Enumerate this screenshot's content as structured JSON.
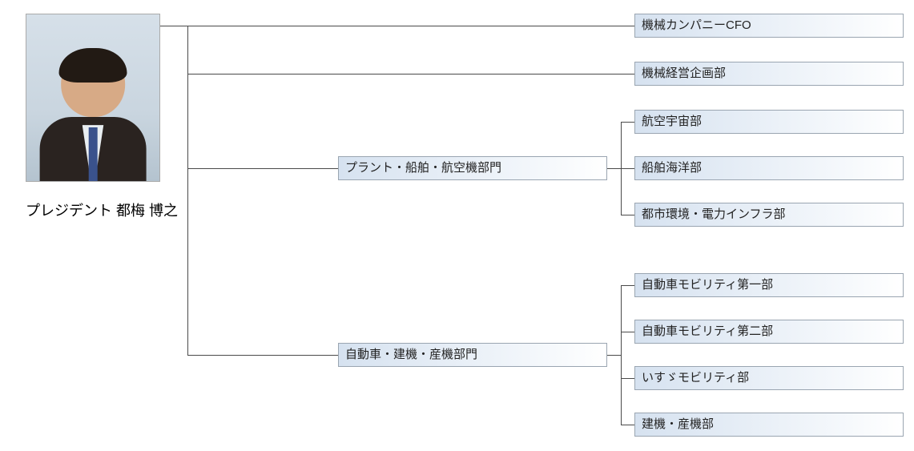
{
  "president": {
    "title_prefix": "プレジデント",
    "name": "都梅 博之"
  },
  "directs": {
    "cfo": "機械カンパニーCFO",
    "planning": "機械経営企画部"
  },
  "divisions": [
    {
      "name": "プラント・船舶・航空機部門",
      "departments": [
        "航空宇宙部",
        "船舶海洋部",
        "都市環境・電力インフラ部"
      ]
    },
    {
      "name": "自動車・建機・産機部門",
      "departments": [
        "自動車モビリティ第一部",
        "自動車モビリティ第二部",
        "いすゞモビリティ部",
        "建機・産機部"
      ]
    }
  ]
}
